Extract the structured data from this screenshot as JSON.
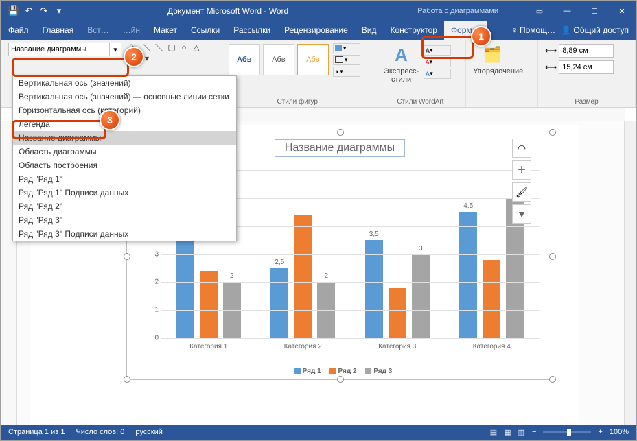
{
  "titlebar": {
    "title": "Документ Microsoft Word - Word",
    "context": "Работа с диаграммами"
  },
  "tabs": [
    "Файл",
    "Главная",
    "Вставка",
    "Дизайн",
    "Макет",
    "Ссылки",
    "Рассылки",
    "Рецензирование",
    "Вид",
    "Конструктор",
    "Формат"
  ],
  "tabs_right": {
    "tellme": "♀ Помощ…",
    "share": "Общий доступ"
  },
  "ribbon": {
    "selection": "Название диаграммы",
    "style_sample": "Абв",
    "quick_styles": "Экспресс-стили",
    "arrange": "Упорядочение",
    "size": {
      "height": "8,89 см",
      "width": "15,24 см"
    },
    "groups": {
      "shape_styles": "Стили фигур",
      "wordart": "Стили WordArt",
      "size": "Размер"
    }
  },
  "dropdown": [
    "Вертикальная ось (значений)",
    "Вертикальная ось (значений) — основные линии сетки",
    "Горизонтальная ось (категорий)",
    "Легенда",
    "Название диаграммы",
    "Область диаграммы",
    "Область построения",
    "Ряд \"Ряд 1\"",
    "Ряд \"Ряд 1\" Подписи данных",
    "Ряд \"Ряд 2\"",
    "Ряд \"Ряд 3\"",
    "Ряд \"Ряд 3\" Подписи данных"
  ],
  "status": {
    "page": "Страница 1 из 1",
    "words": "Число слов: 0",
    "lang": "русский",
    "zoom": "100%"
  },
  "callouts": [
    "1",
    "2",
    "3"
  ],
  "chart_data": {
    "type": "bar",
    "title": "Название диаграммы",
    "categories": [
      "Категория 1",
      "Категория 2",
      "Категория 3",
      "Категория 4"
    ],
    "series": [
      {
        "name": "Ряд 1",
        "values": [
          4.3,
          2.5,
          3.5,
          4.5
        ],
        "color": "#5b9bd5"
      },
      {
        "name": "Ряд 2",
        "values": [
          2.4,
          4.4,
          1.8,
          2.8
        ],
        "color": "#ed7d31"
      },
      {
        "name": "Ряд 3",
        "values": [
          2,
          2,
          3,
          5
        ],
        "color": "#a5a5a5"
      }
    ],
    "ylim": [
      0,
      6
    ],
    "yticks": [
      0,
      1,
      2,
      3,
      4,
      5,
      6
    ],
    "data_labels_shown": [
      "Ряд 1",
      "Ряд 3"
    ]
  }
}
